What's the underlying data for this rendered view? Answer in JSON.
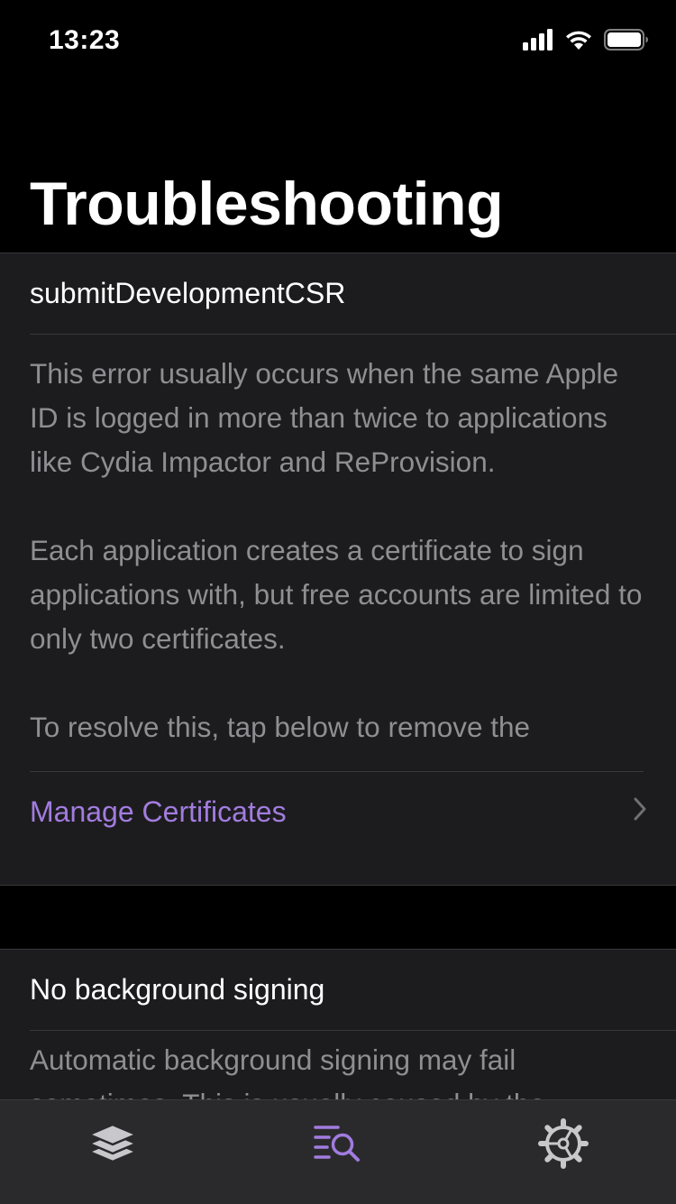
{
  "status_bar": {
    "time": "13:23",
    "icons": [
      "cellular-signal-icon",
      "wifi-icon",
      "battery-icon"
    ]
  },
  "page_title": "Troubleshooting",
  "sections": [
    {
      "title": "submitDevelopmentCSR",
      "paragraphs": [
        "This error usually occurs when the same Apple ID is logged in more than twice to applications like Cydia Impactor and ReProvision.",
        "Each application creates a certificate to sign applications with, but free accounts are limited to only two certificates.",
        "To resolve this, tap below to remove the"
      ],
      "link_label": "Manage Certificates"
    },
    {
      "title": "No background signing",
      "paragraphs": [
        "Automatic background signing may fail sometimes. This is usually caused by the"
      ]
    }
  ],
  "tab_bar": {
    "tabs": [
      {
        "icon": "layers-icon",
        "selected": false
      },
      {
        "icon": "search-list-icon",
        "selected": true
      },
      {
        "icon": "gear-icon",
        "selected": false
      }
    ]
  },
  "colors": {
    "accent": "#a27cdf",
    "background": "#000000",
    "cell_background": "#1c1c1e",
    "secondary_text": "#8e8e93",
    "tab_inactive": "#c7c7cc"
  }
}
